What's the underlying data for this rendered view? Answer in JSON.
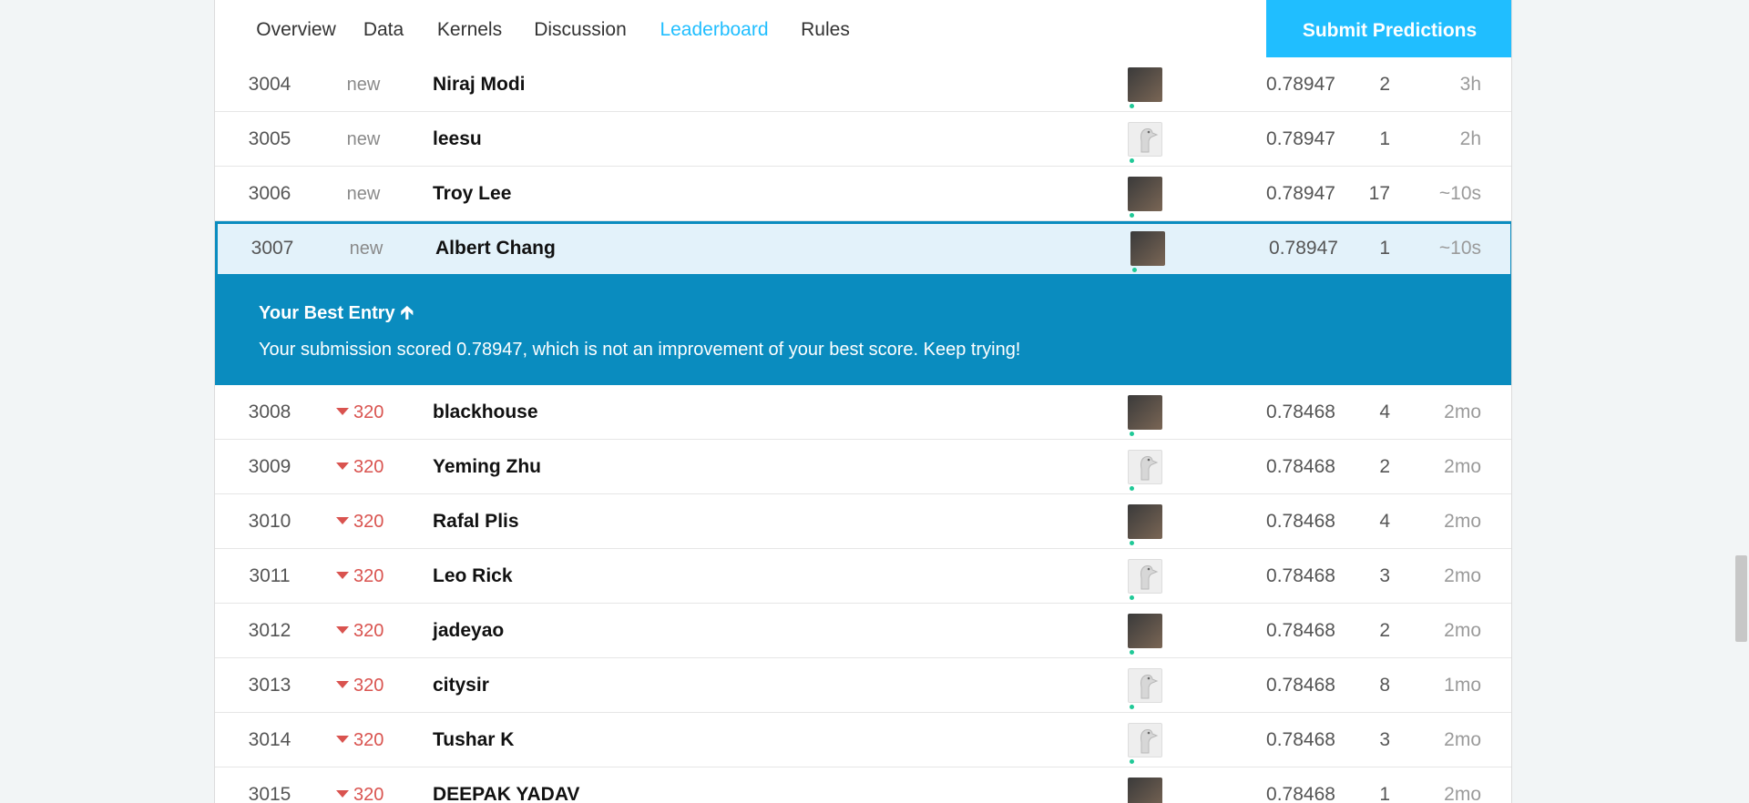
{
  "nav": {
    "tabs": [
      {
        "label": "Overview",
        "active": false
      },
      {
        "label": "Data",
        "active": false
      },
      {
        "label": "Kernels",
        "active": false
      },
      {
        "label": "Discussion",
        "active": false
      },
      {
        "label": "Leaderboard",
        "active": true
      },
      {
        "label": "Rules",
        "active": false
      }
    ],
    "submit_label": "Submit Predictions"
  },
  "colors": {
    "accent": "#20beff",
    "banner": "#0a8cbf",
    "highlight_bg": "#e3f2fa",
    "down": "#d9534f",
    "online_dot": "#20c997"
  },
  "rows_before": [
    {
      "rank": "3004",
      "change": "new",
      "change_type": "new",
      "name": "Niraj Modi",
      "avatar": "photo",
      "score": "0.78947",
      "entries": "2",
      "last": "3h"
    },
    {
      "rank": "3005",
      "change": "new",
      "change_type": "new",
      "name": "leesu",
      "avatar": "goose",
      "score": "0.78947",
      "entries": "1",
      "last": "2h"
    },
    {
      "rank": "3006",
      "change": "new",
      "change_type": "new",
      "name": "Troy Lee",
      "avatar": "photo",
      "score": "0.78947",
      "entries": "17",
      "last": "~10s"
    },
    {
      "rank": "3007",
      "change": "new",
      "change_type": "new",
      "name": "Albert Chang",
      "avatar": "photo",
      "score": "0.78947",
      "entries": "1",
      "last": "~10s",
      "highlight": true
    }
  ],
  "banner": {
    "title": "Your Best Entry",
    "message": "Your submission scored 0.78947, which is not an improvement of your best score. Keep trying!"
  },
  "rows_after": [
    {
      "rank": "3008",
      "change": "320",
      "change_type": "down",
      "name": "blackhouse",
      "avatar": "photo",
      "score": "0.78468",
      "entries": "4",
      "last": "2mo"
    },
    {
      "rank": "3009",
      "change": "320",
      "change_type": "down",
      "name": "Yeming Zhu",
      "avatar": "goose",
      "score": "0.78468",
      "entries": "2",
      "last": "2mo"
    },
    {
      "rank": "3010",
      "change": "320",
      "change_type": "down",
      "name": "Rafal Plis",
      "avatar": "photo",
      "score": "0.78468",
      "entries": "4",
      "last": "2mo"
    },
    {
      "rank": "3011",
      "change": "320",
      "change_type": "down",
      "name": "Leo Rick",
      "avatar": "goose",
      "score": "0.78468",
      "entries": "3",
      "last": "2mo"
    },
    {
      "rank": "3012",
      "change": "320",
      "change_type": "down",
      "name": "jadeyao",
      "avatar": "photo",
      "score": "0.78468",
      "entries": "2",
      "last": "2mo"
    },
    {
      "rank": "3013",
      "change": "320",
      "change_type": "down",
      "name": "citysir",
      "avatar": "goose",
      "score": "0.78468",
      "entries": "8",
      "last": "1mo"
    },
    {
      "rank": "3014",
      "change": "320",
      "change_type": "down",
      "name": "Tushar K",
      "avatar": "goose",
      "score": "0.78468",
      "entries": "3",
      "last": "2mo"
    },
    {
      "rank": "3015",
      "change": "320",
      "change_type": "down",
      "name": "DEEPAK YADAV",
      "avatar": "photo",
      "score": "0.78468",
      "entries": "1",
      "last": "2mo"
    }
  ]
}
